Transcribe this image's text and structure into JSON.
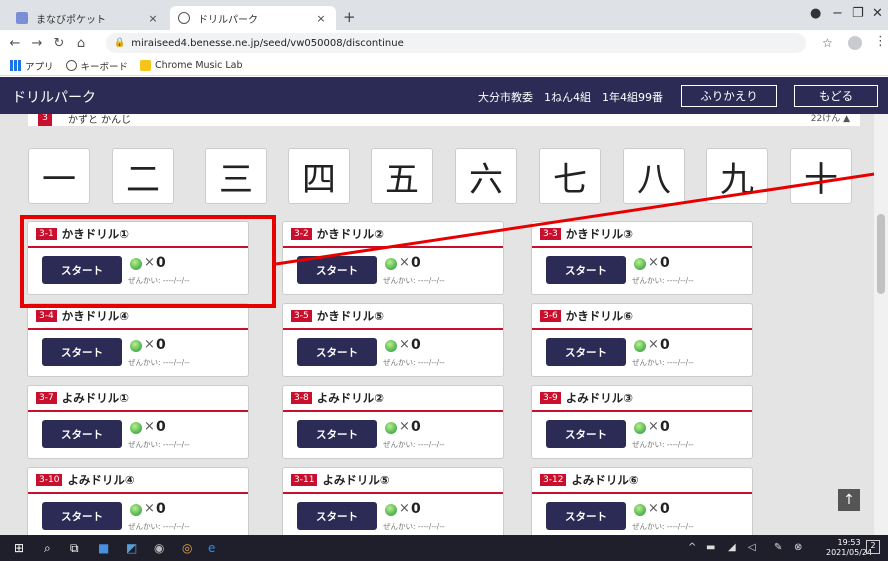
{
  "browser": {
    "tabs": [
      {
        "title": "まなびポケット",
        "close": "×"
      },
      {
        "title": "ドリルパーク",
        "close": "×"
      }
    ],
    "new_tab": "+",
    "url": "miraiseed4.benesse.ne.jp/seed/vw050008/discontinue",
    "bookmarks": [
      "アプリ",
      "キーボード",
      "Chrome Music Lab"
    ]
  },
  "app": {
    "title": "ドリルパーク",
    "user_info": "大分市教委　1ねん4組　1年4組99番",
    "review_button": "ふりかえり",
    "back_button": "もどる"
  },
  "section": {
    "number": "3",
    "title": "かずと かんじ",
    "count": "22けん ▲"
  },
  "kanji": [
    "一",
    "二",
    "三",
    "四",
    "五",
    "六",
    "七",
    "八",
    "九",
    "十"
  ],
  "drills": [
    {
      "id": "3-1",
      "title": "かきドリル①"
    },
    {
      "id": "3-2",
      "title": "かきドリル②"
    },
    {
      "id": "3-3",
      "title": "かきドリル③"
    },
    {
      "id": "3-4",
      "title": "かきドリル④"
    },
    {
      "id": "3-5",
      "title": "かきドリル⑤"
    },
    {
      "id": "3-6",
      "title": "かきドリル⑥"
    },
    {
      "id": "3-7",
      "title": "よみドリル①"
    },
    {
      "id": "3-8",
      "title": "よみドリル②"
    },
    {
      "id": "3-9",
      "title": "よみドリル③"
    },
    {
      "id": "3-10",
      "title": "よみドリル④"
    },
    {
      "id": "3-11",
      "title": "よみドリル⑤"
    },
    {
      "id": "3-12",
      "title": "よみドリル⑥"
    }
  ],
  "drill_card": {
    "start_label": "スタート",
    "times": "×",
    "count": "0",
    "last_date": "ぜんかい: ----/--/--"
  },
  "totop": "↑",
  "taskbar": {
    "time": "19:53",
    "date": "2021/05/24",
    "notifications": "2"
  }
}
